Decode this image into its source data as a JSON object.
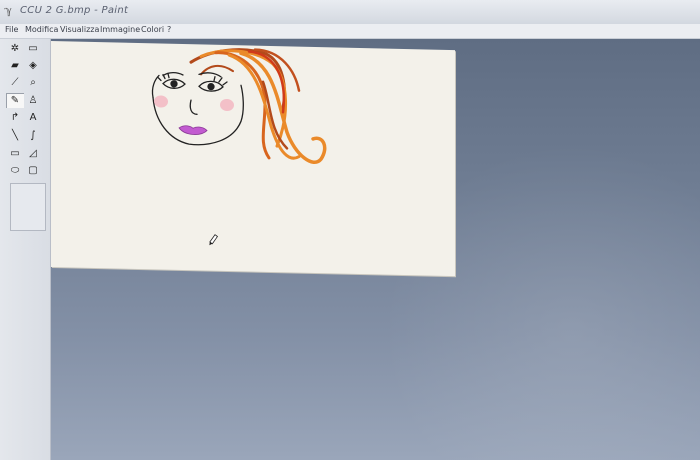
{
  "window": {
    "title": "CCU 2 G.bmp - Paint",
    "icon": "paint-app-icon"
  },
  "menu": {
    "items": [
      "File",
      "Modifica",
      "Visualizza",
      "Immagine",
      "Colori",
      "?"
    ]
  },
  "toolbox": {
    "tools": [
      {
        "name": "free-select-icon",
        "glyph": "✲"
      },
      {
        "name": "rect-select-icon",
        "glyph": "▭"
      },
      {
        "name": "eraser-icon",
        "glyph": "▰"
      },
      {
        "name": "fill-icon",
        "glyph": "◈"
      },
      {
        "name": "color-picker-icon",
        "glyph": "⟋"
      },
      {
        "name": "magnifier-icon",
        "glyph": "⌕"
      },
      {
        "name": "pencil-icon",
        "glyph": "✎"
      },
      {
        "name": "brush-icon",
        "glyph": "♙"
      },
      {
        "name": "airbrush-icon",
        "glyph": "↱"
      },
      {
        "name": "text-icon",
        "glyph": "A"
      },
      {
        "name": "line-icon",
        "glyph": "╲"
      },
      {
        "name": "curve-icon",
        "glyph": "∫"
      },
      {
        "name": "rectangle-icon",
        "glyph": "▭"
      },
      {
        "name": "polygon-icon",
        "glyph": "◿"
      },
      {
        "name": "ellipse-icon",
        "glyph": "⬭"
      },
      {
        "name": "rounded-rect-icon",
        "glyph": "▢"
      }
    ],
    "selected": "pencil-icon"
  },
  "colors": {
    "canvas": "#f3f1ea",
    "hair_dark": "#b34a1b",
    "hair_light": "#ea8a2a",
    "hair_red": "#d03a1a",
    "blush": "#f2b7c2",
    "lips": "#c25bd0",
    "ink": "#222222"
  }
}
